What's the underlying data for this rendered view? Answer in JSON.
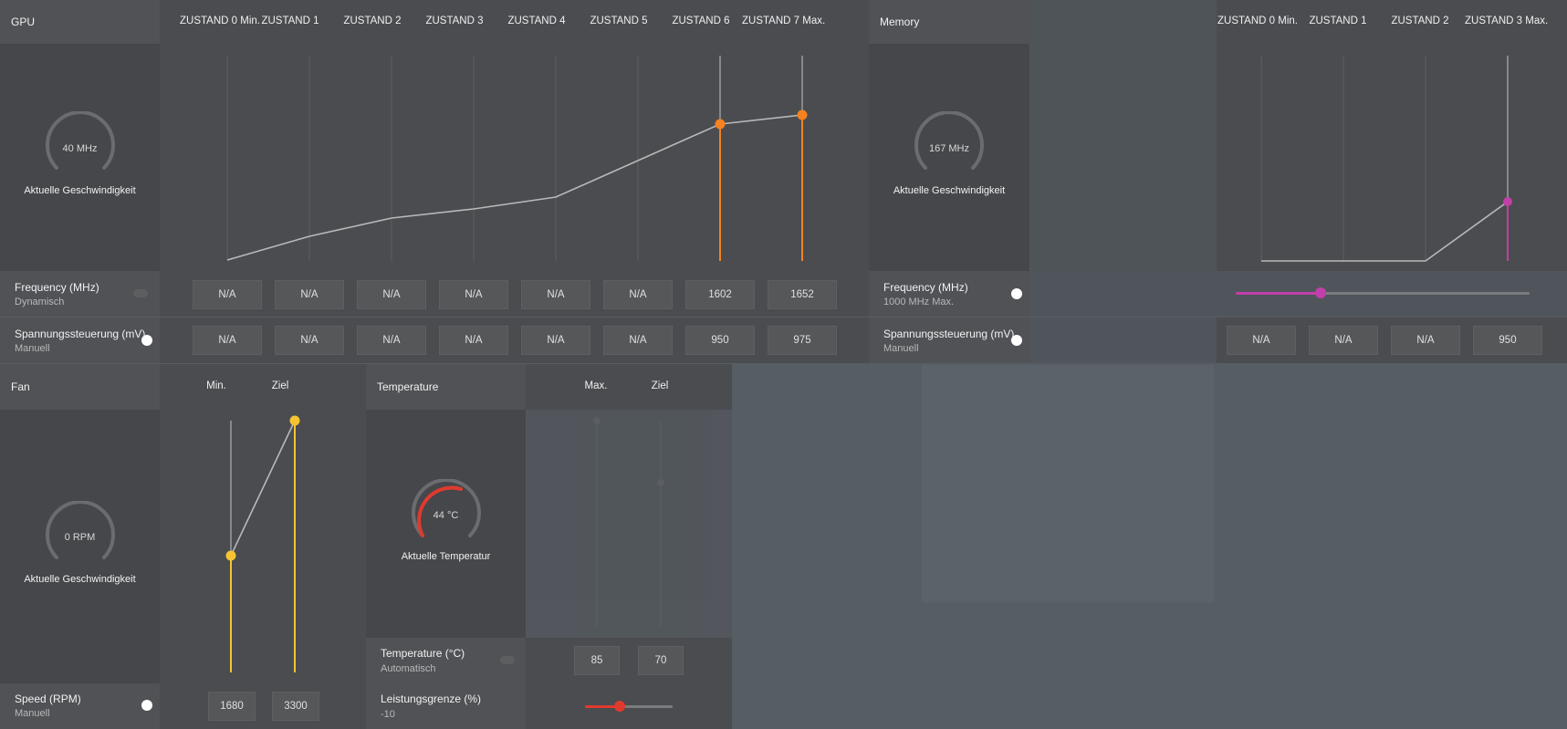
{
  "gpu": {
    "title": "GPU",
    "states": [
      "ZUSTAND 0 Min.",
      "ZUSTAND 1",
      "ZUSTAND 2",
      "ZUSTAND 3",
      "ZUSTAND 4",
      "ZUSTAND 5",
      "ZUSTAND 6",
      "ZUSTAND 7 Max."
    ],
    "gauge_value": "40 MHz",
    "gauge_label": "Aktuelle Geschwindigkeit",
    "frequency": {
      "label": "Frequency (MHz)",
      "mode": "Dynamisch",
      "values": [
        "N/A",
        "N/A",
        "N/A",
        "N/A",
        "N/A",
        "N/A",
        "1602",
        "1652"
      ]
    },
    "voltage": {
      "label": "Spannungssteuerung (mV)",
      "mode": "Manuell",
      "values": [
        "N/A",
        "N/A",
        "N/A",
        "N/A",
        "N/A",
        "N/A",
        "950",
        "975"
      ]
    },
    "accent": "#f58220"
  },
  "memory": {
    "title": "Memory",
    "states": [
      "ZUSTAND 0 Min.",
      "ZUSTAND 1",
      "ZUSTAND 2",
      "ZUSTAND 3 Max."
    ],
    "gauge_value": "167 MHz",
    "gauge_label": "Aktuelle Geschwindigkeit",
    "frequency": {
      "label": "Frequency (MHz)",
      "mode": "1000 MHz Max.",
      "slider_fraction": 0.29
    },
    "voltage": {
      "label": "Spannungssteuerung (mV)",
      "mode": "Manuell",
      "values": [
        "N/A",
        "N/A",
        "N/A",
        "950"
      ]
    },
    "accent": "#c13fa8"
  },
  "fan": {
    "title": "Fan",
    "columns": [
      "Min.",
      "Ziel"
    ],
    "gauge_value": "0 RPM",
    "gauge_label": "Aktuelle Geschwindigkeit",
    "speed": {
      "label": "Speed (RPM)",
      "mode": "Manuell",
      "values": [
        "1680",
        "3300"
      ]
    },
    "accent": "#f6c333"
  },
  "temperature": {
    "title": "Temperature",
    "columns": [
      "Max.",
      "Ziel"
    ],
    "gauge_value": "44 °C",
    "gauge_label": "Aktuelle Temperatur",
    "temp": {
      "label": "Temperature (°C)",
      "mode": "Automatisch",
      "values": [
        "85",
        "70"
      ]
    },
    "power": {
      "label": "Leistungsgrenze (%)",
      "value": "-10",
      "slider_fraction": 0.4
    },
    "accent": "#e03a2f"
  }
}
